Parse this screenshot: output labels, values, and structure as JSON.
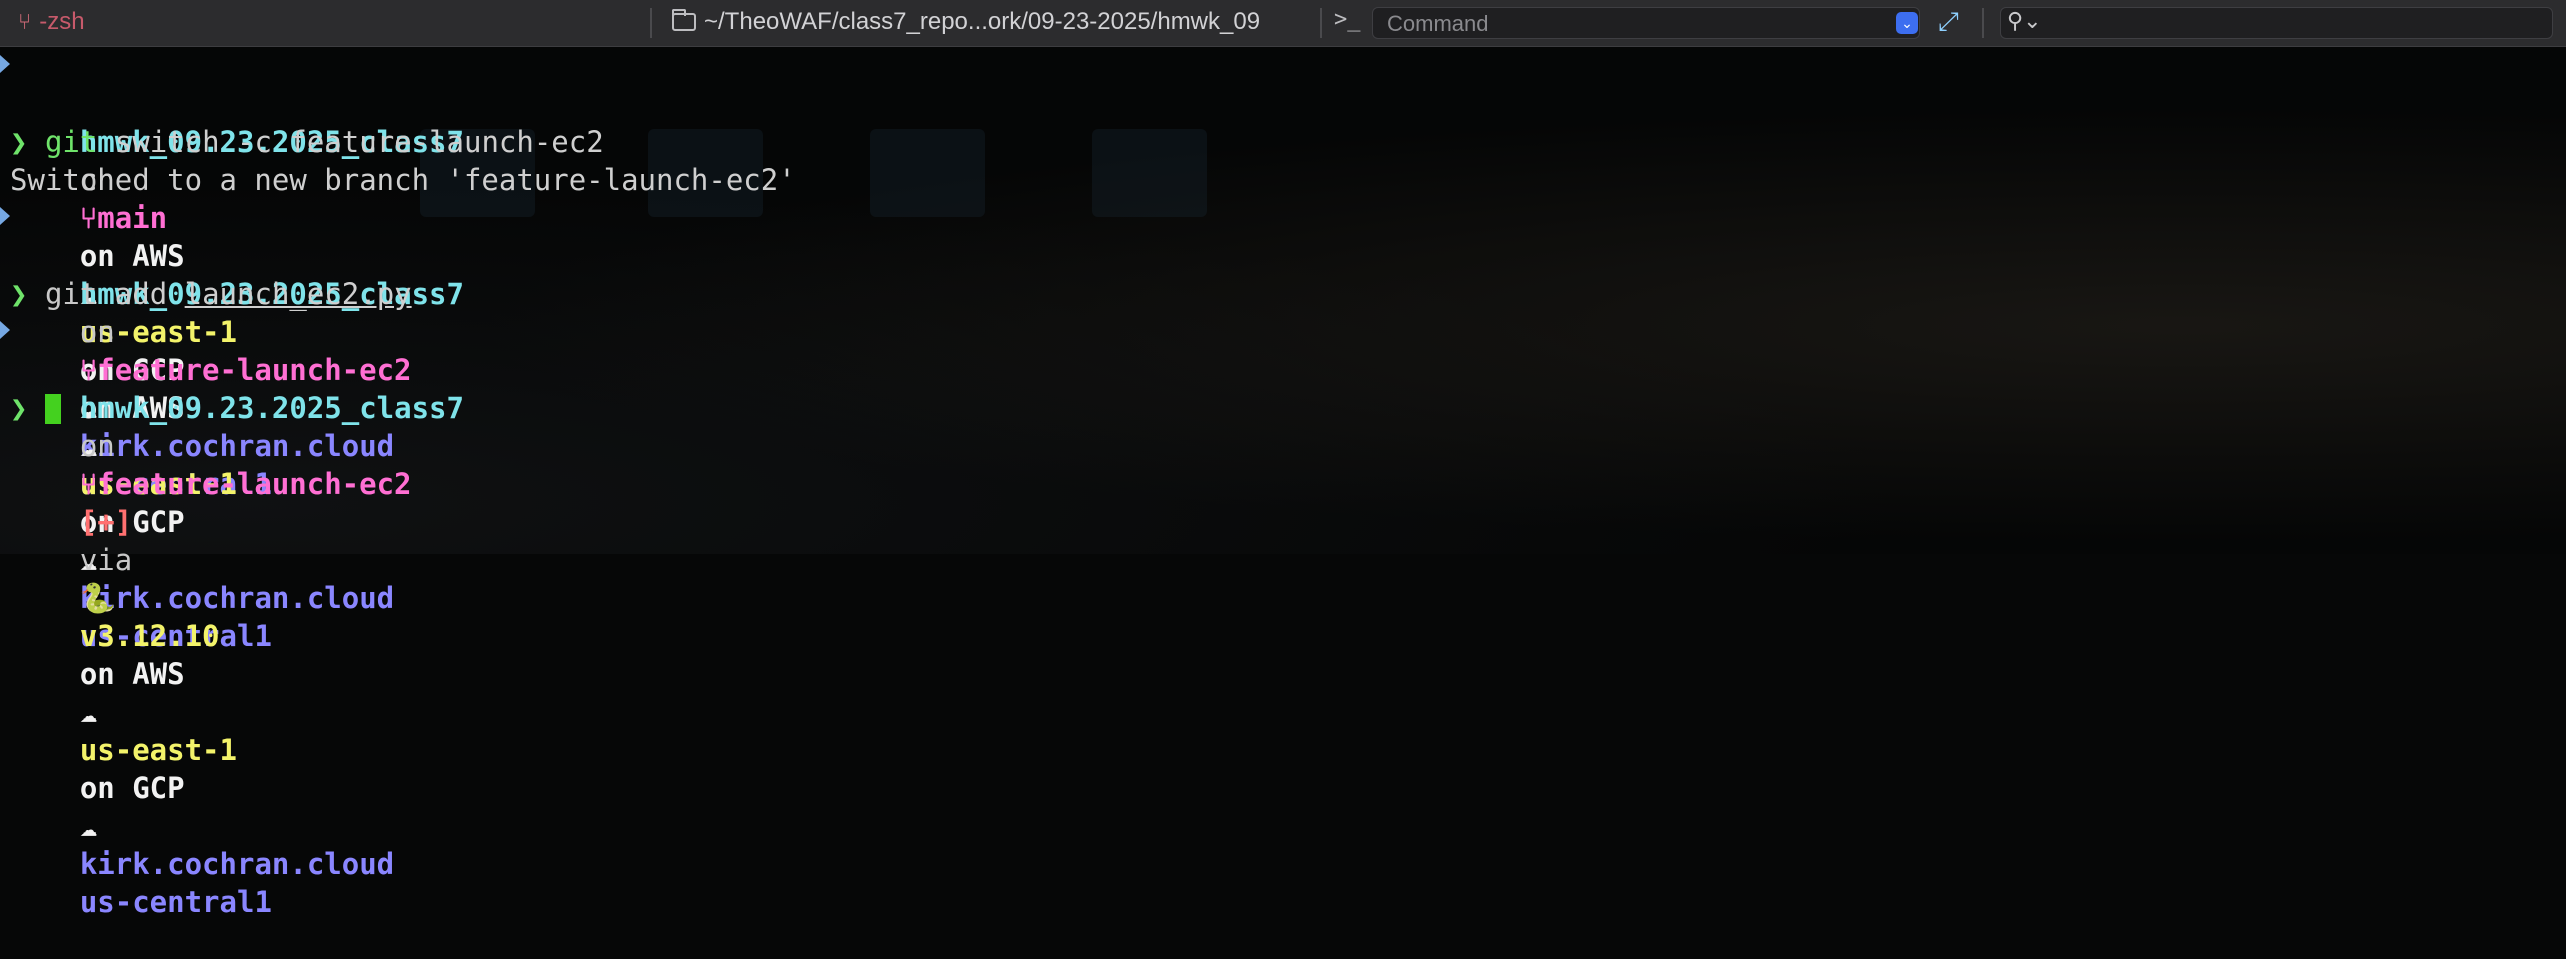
{
  "window": {
    "tab_title": "-zsh",
    "path": "~/TheoWAF/class7_repo...ork/09-23-2025/hmwk_09",
    "command_placeholder": "Command",
    "search_placeholder": ""
  },
  "prompts": [
    {
      "dir": "hmwk_09.23.2025_class7",
      "on1": "on",
      "branch": "main",
      "status": "",
      "via": "",
      "python": "",
      "aws_label": "on AWS",
      "aws_region": "us-east-1",
      "gcp_label": "on GCP",
      "gcp_project": "kirk.cochran.cloud",
      "gcp_region": "us-central1"
    },
    {
      "dir": "hmwk_09.23.2025_class7",
      "on1": "on",
      "branch": "feature-launch-ec2",
      "status": "",
      "via": "",
      "python": "",
      "aws_label": "on AWS",
      "aws_region": "us-east-1",
      "gcp_label": "on GCP",
      "gcp_project": "kirk.cochran.cloud",
      "gcp_region": "us-central1"
    },
    {
      "dir": "hmwk_09.23.2025_class7",
      "on1": "on",
      "branch": "feature-launch-ec2",
      "status": "[+]",
      "via": "via",
      "python": "v3.12.10",
      "aws_label": "on AWS",
      "aws_region": "us-east-1",
      "gcp_label": "on GCP",
      "gcp_project": "kirk.cochran.cloud",
      "gcp_region": "us-central1"
    }
  ],
  "commands": [
    {
      "cmd": "git",
      "args": "switch -c feature-launch-ec2"
    },
    {
      "cmd": "git",
      "args": "add ",
      "file": "launch_ec2.py"
    }
  ],
  "output": {
    "switch_msg": "Switched to a new branch 'feature-launch-ec2'"
  },
  "glyphs": {
    "prompt_char": "❯",
    "branch_icon": "branch-icon",
    "cloud": "☁",
    "snake": "🐍"
  },
  "colors": {
    "dir": "#7fe3ea",
    "branch": "#ff6fd3",
    "region": "#f3f36a",
    "gcp": "#8a86ff",
    "prompt": "#6fe36a",
    "cursor": "#44d11f"
  }
}
